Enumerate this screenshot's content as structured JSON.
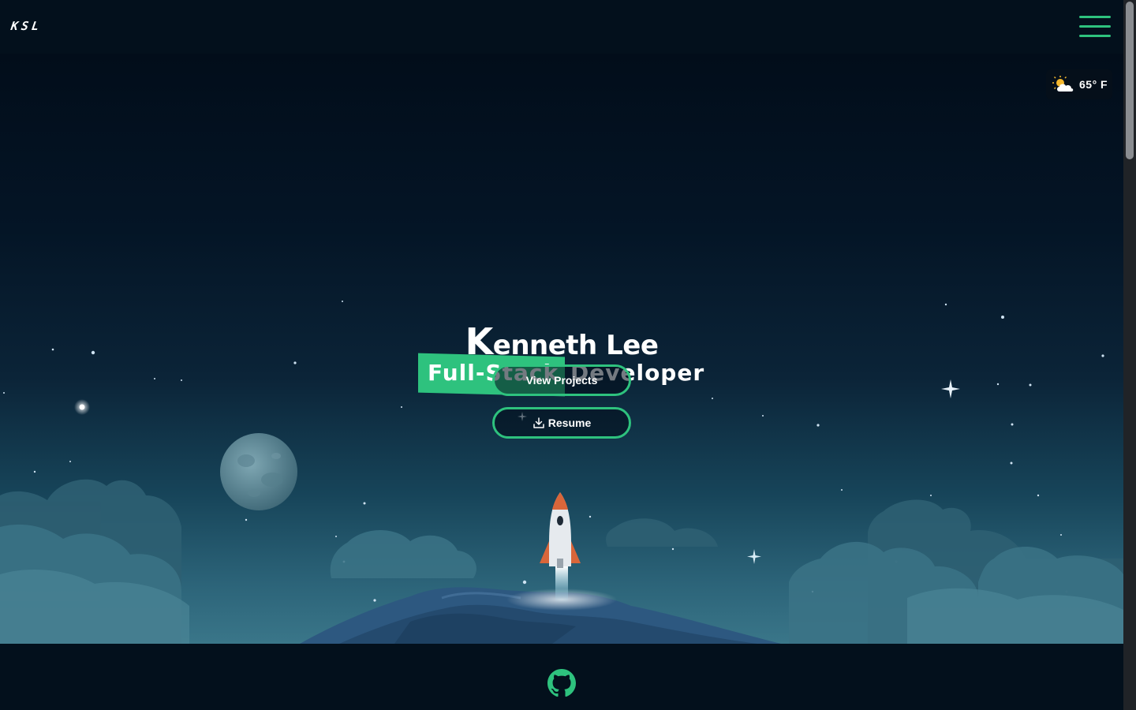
{
  "header": {
    "logo_text": "KSL",
    "menu_icon": "hamburger-menu-icon",
    "accent_color": "#2ec27e"
  },
  "weather": {
    "icon": "partly-cloudy-sun-icon",
    "temperature": "65° F"
  },
  "hero": {
    "name_initial": "K",
    "name_rest": "enneth Lee",
    "highlight_text": "Full-Stack",
    "role_text": "Developer",
    "buttons": {
      "projects_label": "View Projects",
      "resume_label": "Resume",
      "resume_icon": "download-icon"
    }
  },
  "footer": {
    "github_icon": "github-icon"
  }
}
